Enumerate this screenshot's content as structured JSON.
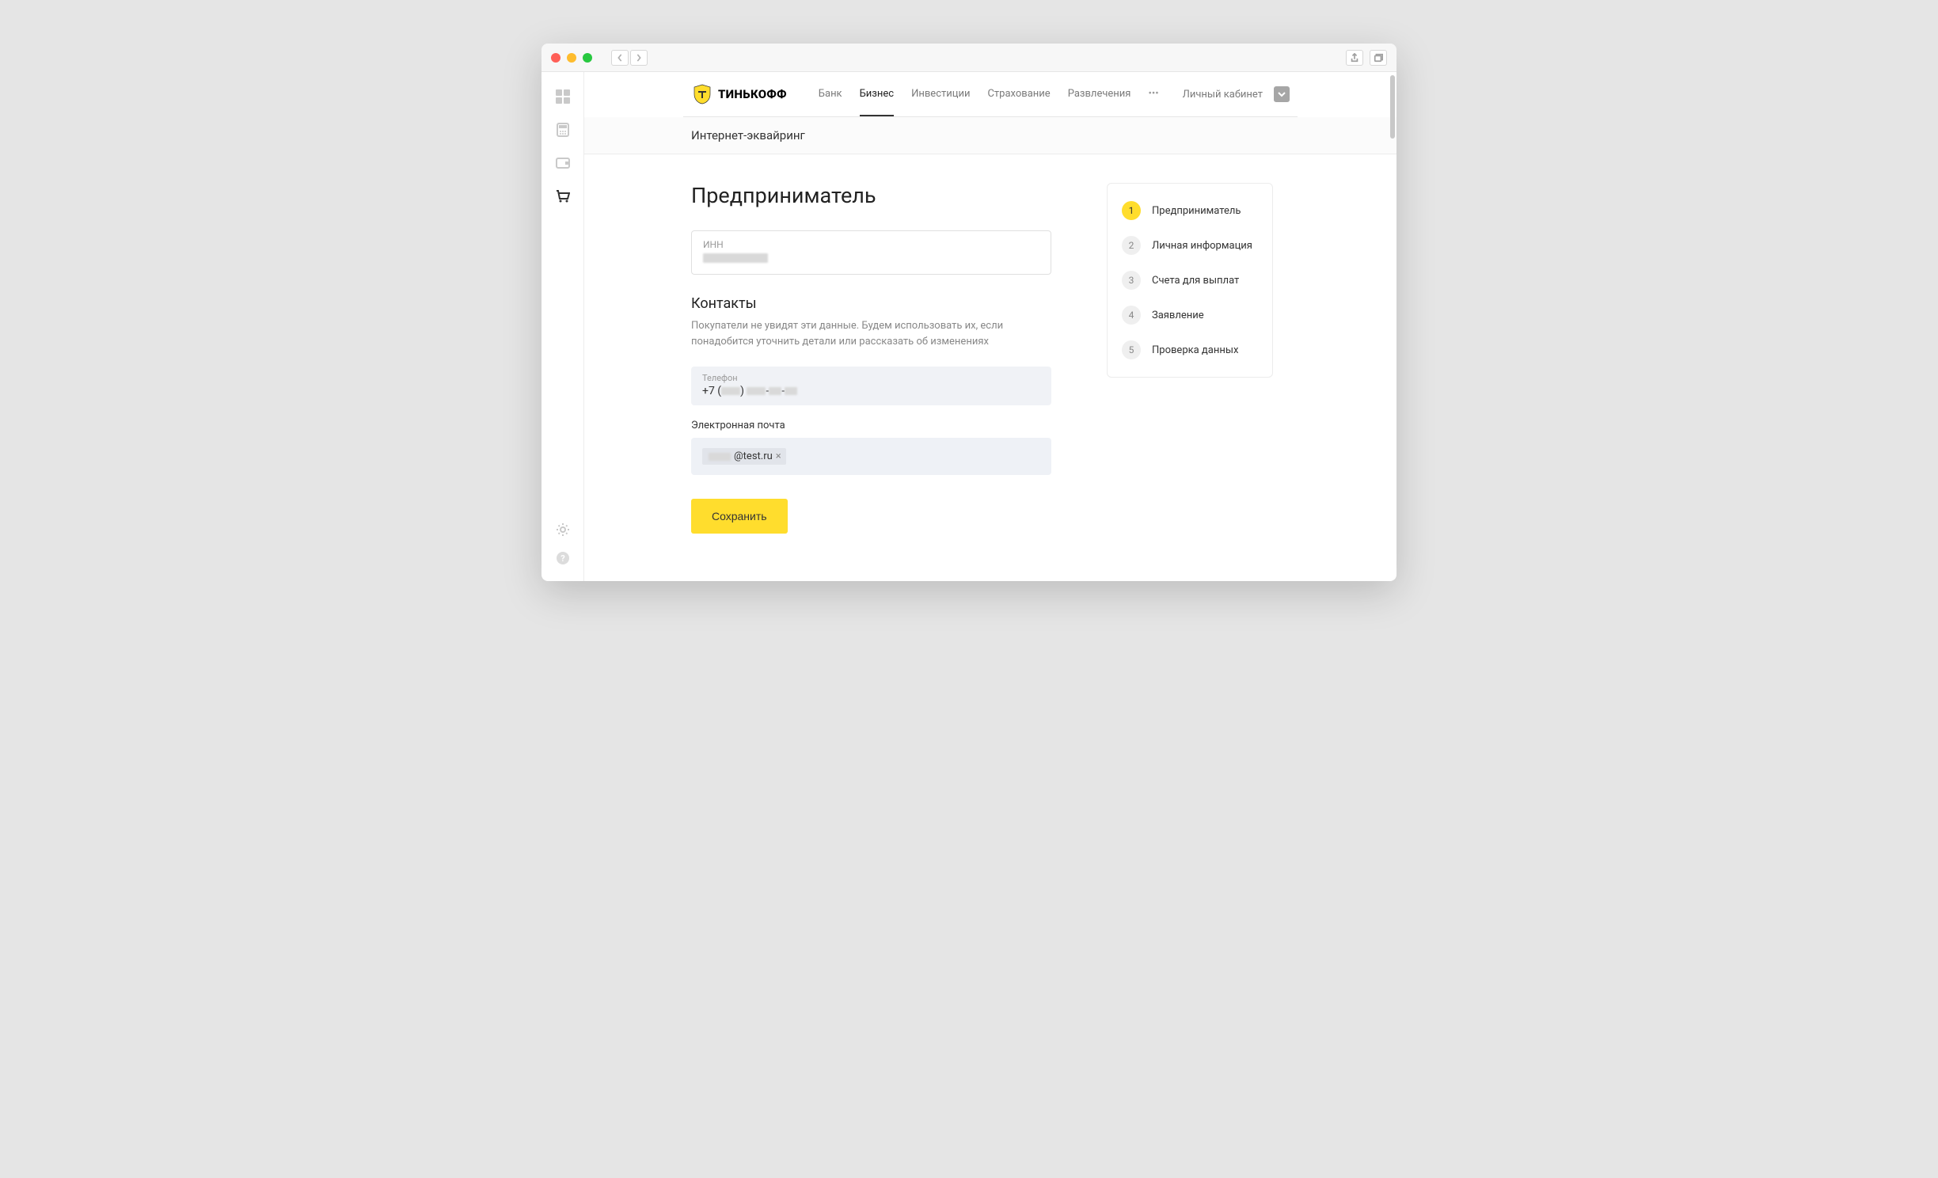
{
  "brand": "ТИНЬКОФФ",
  "nav": {
    "links": [
      "Банк",
      "Бизнес",
      "Инвестиции",
      "Страхование",
      "Развлечения"
    ],
    "active_index": 1,
    "account": "Личный кабинет"
  },
  "subheader": "Интернет-эквайринг",
  "page": {
    "title": "Предприниматель",
    "inn_label": "ИНН",
    "contacts_title": "Контакты",
    "contacts_desc": "Покупатели не увидят эти данные. Будем использовать их, если понадобится уточнить детали или рассказать об изменениях",
    "phone_label": "Телефон",
    "phone_prefix": "+7 (",
    "phone_mid": ") ",
    "phone_dash": "-",
    "email_label": "Электронная почта",
    "email_domain": "@test.ru",
    "save": "Сохранить"
  },
  "steps": [
    {
      "num": "1",
      "label": "Предприниматель",
      "active": true
    },
    {
      "num": "2",
      "label": "Личная информация",
      "active": false
    },
    {
      "num": "3",
      "label": "Счета для выплат",
      "active": false
    },
    {
      "num": "4",
      "label": "Заявление",
      "active": false
    },
    {
      "num": "5",
      "label": "Проверка данных",
      "active": false
    }
  ]
}
